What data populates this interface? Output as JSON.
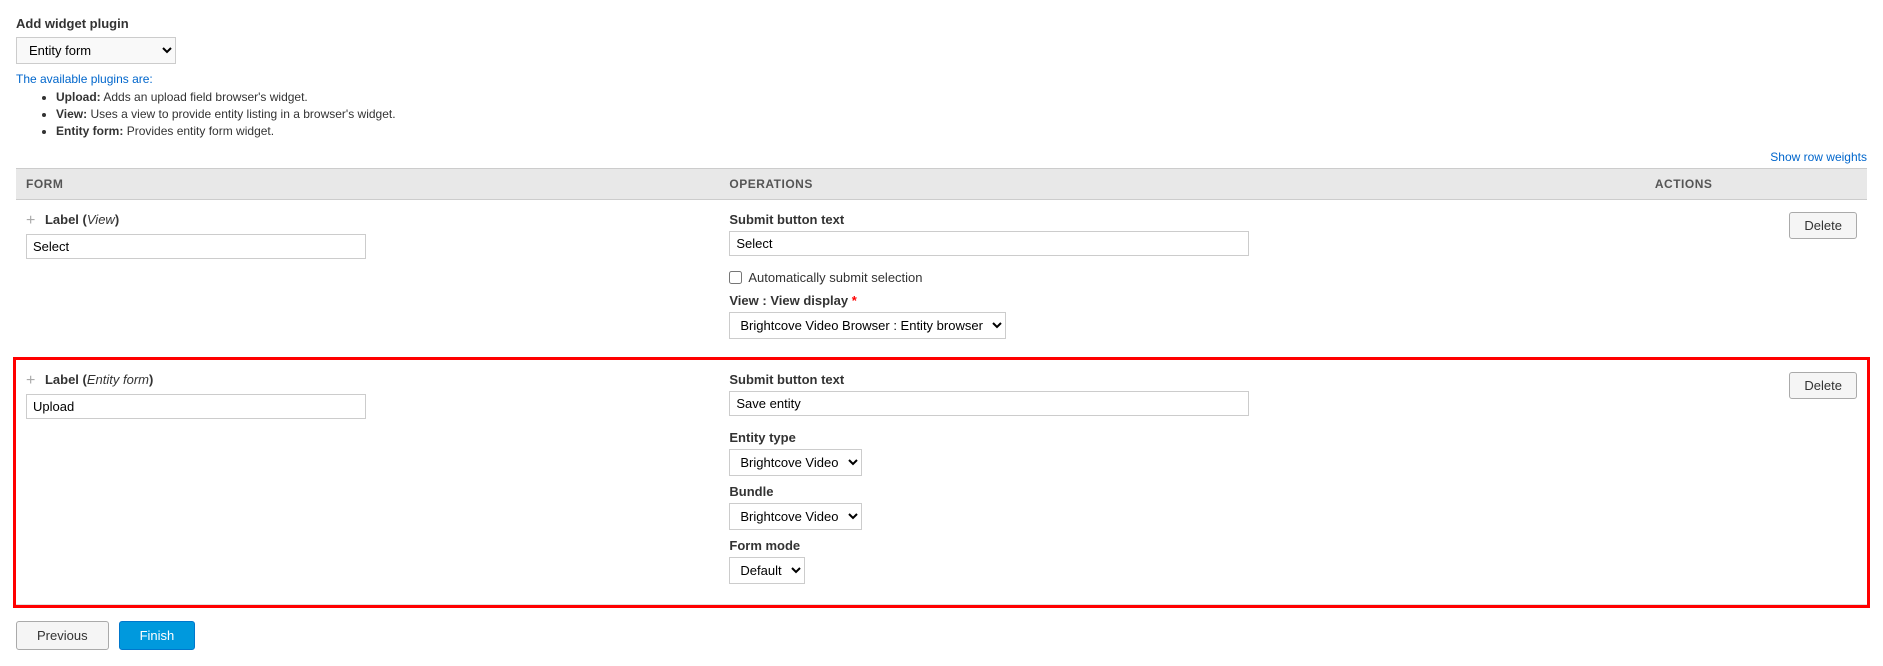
{
  "header": {
    "add_widget_title": "Add widget plugin",
    "select_label": "Entity form",
    "show_row_weights": "Show row weights"
  },
  "available_plugins": {
    "intro": "The available plugins are:",
    "items": [
      {
        "name": "Upload:",
        "desc": "Adds an upload field browser's widget."
      },
      {
        "name": "View:",
        "desc": "Uses a view to provide entity listing in a browser's widget."
      },
      {
        "name": "Entity form:",
        "desc": "Provides entity form widget."
      }
    ]
  },
  "table": {
    "columns": [
      "FORM",
      "OPERATIONS",
      "ACTIONS"
    ],
    "rows": [
      {
        "id": "row1",
        "label": "Label",
        "label_type": "View",
        "input_value": "Select",
        "ops": {
          "submit_button_text_label": "Submit button text",
          "submit_button_text_value": "Select",
          "auto_submit_label": "Automatically submit selection",
          "auto_submit_checked": false,
          "view_display_label": "View : View display",
          "view_display_required": true,
          "view_display_value": "Brightcove Video Browser : Entity browser",
          "view_display_options": [
            "Brightcove Video Browser : Entity browser"
          ]
        },
        "action": "Delete",
        "highlighted": false
      },
      {
        "id": "row2",
        "label": "Label",
        "label_type": "Entity form",
        "input_value": "Upload",
        "ops": {
          "submit_button_text_label": "Submit button text",
          "submit_button_text_value": "Save entity",
          "entity_type_label": "Entity type",
          "entity_type_value": "Brightcove Video",
          "entity_type_options": [
            "Brightcove Video"
          ],
          "bundle_label": "Bundle",
          "bundle_value": "Brightcove Video",
          "bundle_options": [
            "Brightcove Video"
          ],
          "form_mode_label": "Form mode",
          "form_mode_value": "Default",
          "form_mode_options": [
            "Default"
          ]
        },
        "action": "Delete",
        "highlighted": true
      }
    ]
  },
  "buttons": {
    "previous": "Previous",
    "finish": "Finish"
  }
}
